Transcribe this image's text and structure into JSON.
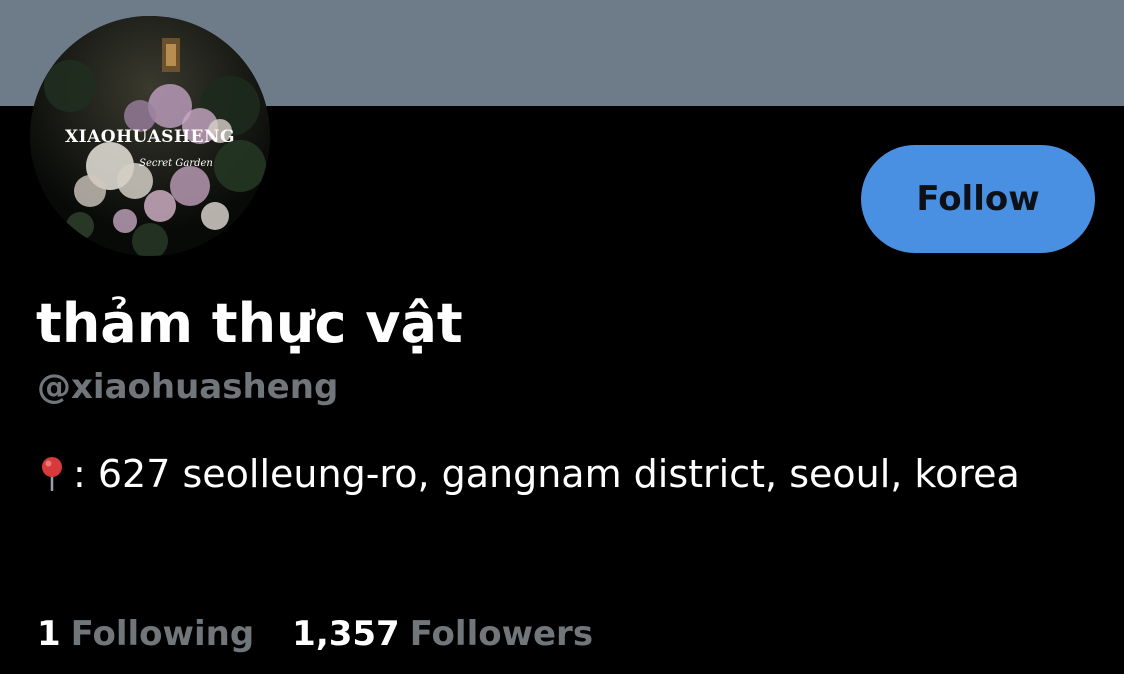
{
  "profile": {
    "avatar_text": "XIAOHUASHENG",
    "avatar_subtext": "Secret Garden",
    "display_name": "thảm thực vật",
    "handle": "@xiaohuasheng",
    "bio_icon": "round-pushpin-icon",
    "bio_text": ": 627 seolleung-ro, gangnam district, seoul, korea",
    "follow_label": "Follow"
  },
  "stats": {
    "following_count": "1",
    "following_label": "Following",
    "followers_count": "1,357",
    "followers_label": "Followers"
  },
  "colors": {
    "banner": "#6e7b89",
    "background": "#000000",
    "accent_button": "#4a90e2",
    "muted_text": "#71767b"
  }
}
